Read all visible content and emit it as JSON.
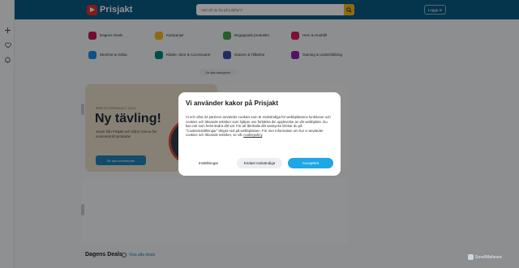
{
  "header": {
    "logo_text": "Prisjakt",
    "search_placeholder": "Vad vill du ha på julafton?",
    "login_label": "Logga in",
    "brand_color": "#0a5b86"
  },
  "categories": [
    {
      "label": "Dagens Deals",
      "color": "#c2185b"
    },
    {
      "label": "Kampanjer",
      "color": "#f5b81c"
    },
    {
      "label": "Begagnade produkter",
      "color": "#43a047"
    },
    {
      "label": "Hem & Hushåll",
      "color": "#d81b60"
    },
    {
      "label": "Skönhet & Hälsa",
      "color": "#1e88e5"
    },
    {
      "label": "Kläder, Skor & Accessoarer",
      "color": "#00897b"
    },
    {
      "label": "Datorer & Tillbehör",
      "color": "#3949ab"
    },
    {
      "label": "Gaming & Underhållning",
      "color": "#8e24aa"
    }
  ],
  "all_categories_label": "Se alla kategorier",
  "banner": {
    "eyebrow": "ÅRETS PRODUKT 2024",
    "title": "Ny tävling!",
    "text": "Jurym från Prisjakt och Gård i test av fler nummerat 60 produkter",
    "cta": "Se alla nominerade"
  },
  "deals": {
    "title": "Dagens Deals",
    "link": "Visa alla deals"
  },
  "cookie_modal": {
    "title": "Vi använder kakor på Prisjakt",
    "body_prefix": "Vi och våra 32 partners använder cookies som är nödvändiga för webbplatsens funktioner och cookies och liknande tekniker som hjälper oss förbättra din upplevelse av vår webbplats. Du kan när som helst ändra ditt val. För att återkalla ditt samtycke klickar du på \"Cookieinställningar\" längst ned på webbplatsen. För mer information om hur vi använder cookies och liknande tekniker, se vår",
    "body_link": "cookiepolicy",
    "body_suffix": ".",
    "btn_settings": "Inställningar",
    "btn_necessary": "Endast nödvändiga",
    "btn_accept": "Acceptera"
  },
  "watermark": "SmallMalware"
}
